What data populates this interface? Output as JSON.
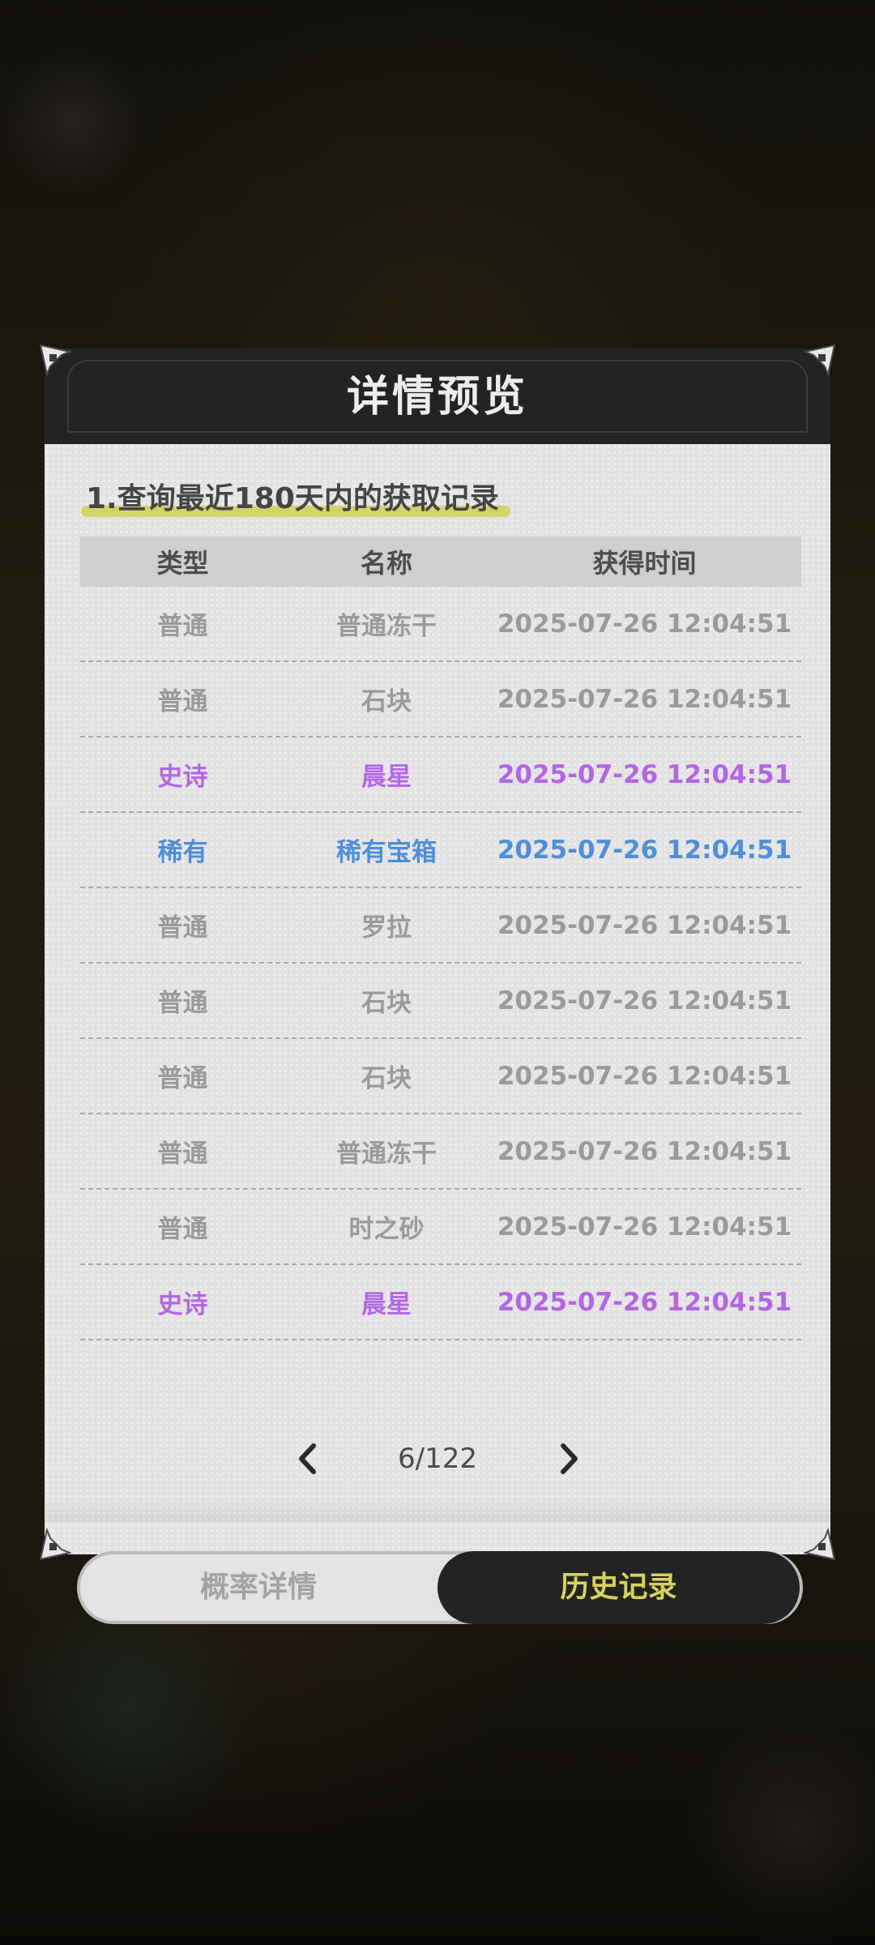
{
  "dialog": {
    "title": "详情预览",
    "subtitle": "1.查询最近180天内的获取记录"
  },
  "table": {
    "headers": [
      "类型",
      "名称",
      "获得时间"
    ],
    "rows": [
      {
        "type": "普通",
        "name": "普通冻干",
        "time": "2025-07-26 12:04:51"
      },
      {
        "type": "普通",
        "name": "石块",
        "time": "2025-07-26 12:04:51"
      },
      {
        "type": "史诗",
        "name": "晨星",
        "time": "2025-07-26 12:04:51"
      },
      {
        "type": "稀有",
        "name": "稀有宝箱",
        "time": "2025-07-26 12:04:51"
      },
      {
        "type": "普通",
        "name": "罗拉",
        "time": "2025-07-26 12:04:51"
      },
      {
        "type": "普通",
        "name": "石块",
        "time": "2025-07-26 12:04:51"
      },
      {
        "type": "普通",
        "name": "石块",
        "time": "2025-07-26 12:04:51"
      },
      {
        "type": "普通",
        "name": "普通冻干",
        "time": "2025-07-26 12:04:51"
      },
      {
        "type": "普通",
        "name": "时之砂",
        "time": "2025-07-26 12:04:51"
      },
      {
        "type": "史诗",
        "name": "晨星",
        "time": "2025-07-26 12:04:51"
      }
    ]
  },
  "pagination": {
    "label": "6/122",
    "prev_icon": "chevron-left-icon",
    "next_icon": "chevron-right-icon"
  },
  "tabs": {
    "probability": "概率详情",
    "history": "历史记录"
  },
  "colors": {
    "common": "#9a9a9a",
    "epic": "#b366e2",
    "rare": "#4f8ed8",
    "header_bg": "#232323",
    "highlight": "#d3d36a",
    "active_tab_text": "#d6d25f"
  }
}
